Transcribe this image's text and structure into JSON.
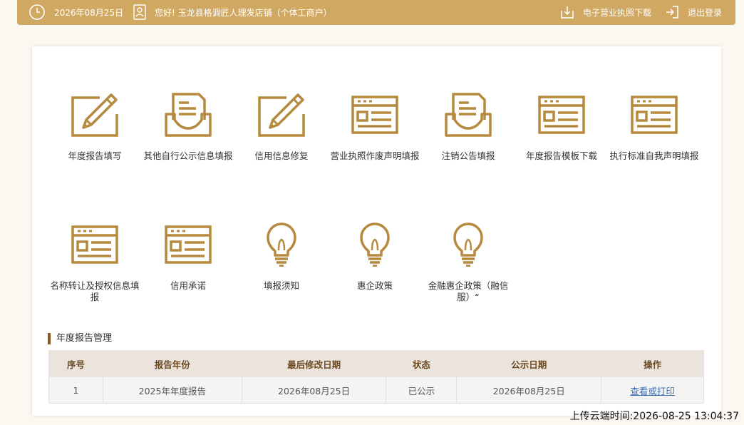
{
  "topbar": {
    "date": "2026年08月25日",
    "greeting": "您好! 玉龙县格调匠人理发店铺（个体工商户）",
    "download_license": "电子营业执照下载",
    "logout": "退出登录"
  },
  "tiles": [
    {
      "label": "年度报告填写",
      "icon": "edit-pencil-icon"
    },
    {
      "label": "其他自行公示信息填报",
      "icon": "inbox-document-icon"
    },
    {
      "label": "信用信息修复",
      "icon": "edit-pencil-icon"
    },
    {
      "label": "营业执照作废声明填报",
      "icon": "web-form-icon"
    },
    {
      "label": "注销公告填报",
      "icon": "inbox-document-icon"
    },
    {
      "label": "年度报告模板下载",
      "icon": "web-form-icon"
    },
    {
      "label": "执行标准自我声明填报",
      "icon": "web-form-icon"
    },
    {
      "label": "名称转让及授权信息填报",
      "icon": "web-form-icon"
    },
    {
      "label": "信用承诺",
      "icon": "web-form-icon"
    },
    {
      "label": "填报须知",
      "icon": "lightbulb-icon"
    },
    {
      "label": "惠企政策",
      "icon": "lightbulb-icon"
    },
    {
      "label": "金融惠企政策（融信服）“",
      "icon": "lightbulb-icon"
    }
  ],
  "report_section": {
    "title": "年度报告管理",
    "headers": [
      "序号",
      "报告年份",
      "最后修改日期",
      "状态",
      "公示日期",
      "操作"
    ],
    "rows": [
      {
        "index": "1",
        "year": "2025年年度报告",
        "modified": "2026年08月25日",
        "status": "已公示",
        "published": "2026年08月25日",
        "action": "查看或打印"
      }
    ]
  },
  "upload_time": "上传云端时间:2026-08-25 13:04:37",
  "colors": {
    "accent": "#d0a862",
    "icon": "#b68a3e",
    "header_text": "#6b4a23"
  }
}
